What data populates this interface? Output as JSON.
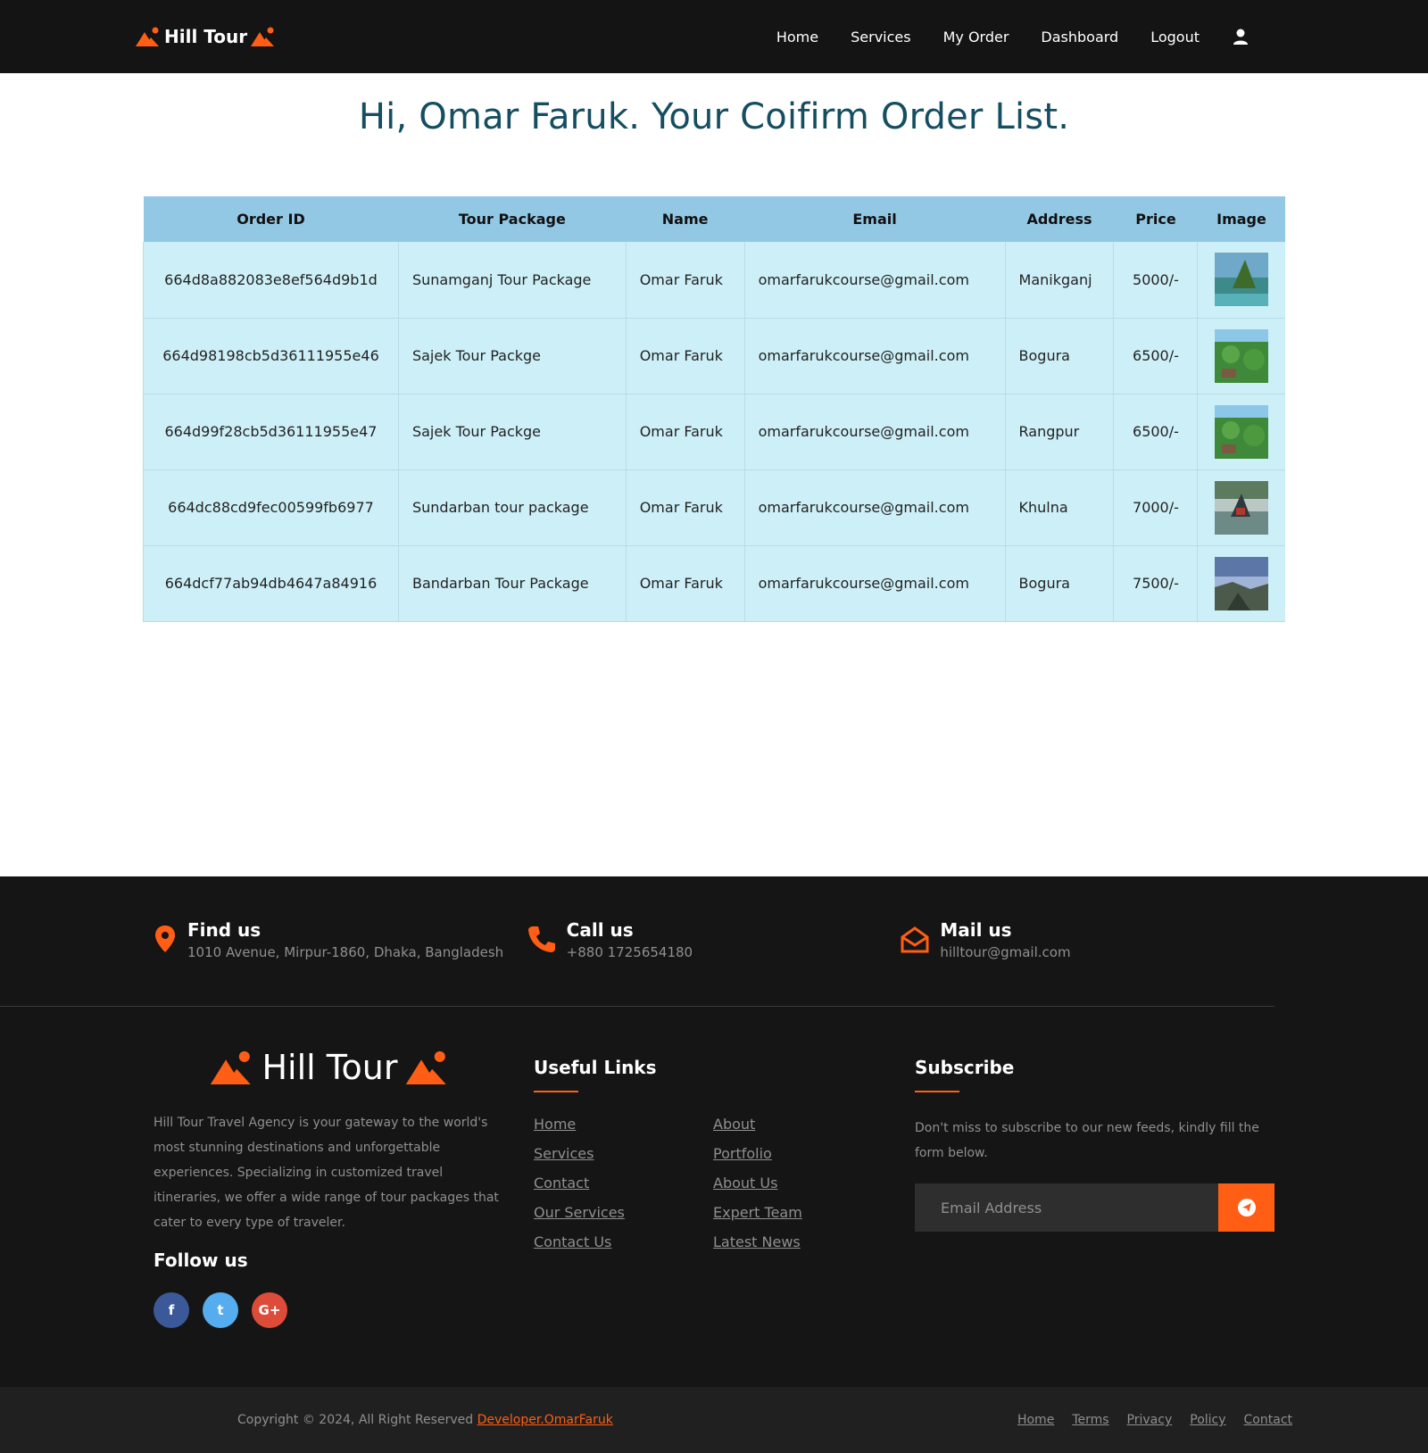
{
  "brand": {
    "name": "Hill Tour"
  },
  "nav": {
    "items": [
      "Home",
      "Services",
      "My Order",
      "Dashboard",
      "Logout"
    ],
    "user_icon": "user-icon"
  },
  "page": {
    "title": "Hi, Omar Faruk. Your Coifirm Order List."
  },
  "orders": {
    "headers": [
      "Order ID",
      "Tour Package",
      "Name",
      "Email",
      "Address",
      "Price",
      "Image"
    ],
    "rows": [
      {
        "id": "664d8a882083e8ef564d9b1d",
        "package": "Sunamganj Tour Package",
        "name": "Omar Faruk",
        "email": "omarfarukcourse@gmail.com",
        "address": "Manikganj",
        "price": "5000/-"
      },
      {
        "id": "664d98198cb5d36111955e46",
        "package": "Sajek Tour Packge",
        "name": "Omar Faruk",
        "email": "omarfarukcourse@gmail.com",
        "address": "Bogura",
        "price": "6500/-"
      },
      {
        "id": "664d99f28cb5d36111955e47",
        "package": "Sajek Tour Packge",
        "name": "Omar Faruk",
        "email": "omarfarukcourse@gmail.com",
        "address": "Rangpur",
        "price": "6500/-"
      },
      {
        "id": "664dc88cd9fec00599fb6977",
        "package": "Sundarban tour package",
        "name": "Omar Faruk",
        "email": "omarfarukcourse@gmail.com",
        "address": "Khulna",
        "price": "7000/-"
      },
      {
        "id": "664dcf77ab94db4647a84916",
        "package": "Bandarban Tour Package",
        "name": "Omar Faruk",
        "email": "omarfarukcourse@gmail.com",
        "address": "Bogura",
        "price": "7500/-"
      }
    ]
  },
  "footer": {
    "contacts": [
      {
        "title": "Find us",
        "text": "1010 Avenue, Mirpur-1860, Dhaka, Bangladesh",
        "icon": "map-pin-icon"
      },
      {
        "title": "Call us",
        "text": "+880 1725654180",
        "icon": "phone-icon"
      },
      {
        "title": "Mail us",
        "text": "hilltour@gmail.com",
        "icon": "envelope-open-icon"
      }
    ],
    "logo_text": "Hill Tour",
    "about": "Hill Tour Travel Agency is your gateway to the world's most stunning destinations and unforgettable experiences. Specializing in customized travel itineraries, we offer a wide range of tour packages that cater to every type of traveler.",
    "follow_title": "Follow us",
    "social": [
      {
        "name": "facebook",
        "glyph": "f"
      },
      {
        "name": "twitter",
        "glyph": "t"
      },
      {
        "name": "google-plus",
        "glyph": "G+"
      }
    ],
    "useful_links_title": "Useful Links",
    "useful_links": [
      "Home",
      "About",
      "Services",
      "Portfolio",
      "Contact",
      "About Us",
      "Our Services",
      "Expert Team",
      "Contact Us",
      "Latest News"
    ],
    "subscribe_title": "Subscribe",
    "subscribe_text": "Don't miss to subscribe to our new feeds, kindly fill the form below.",
    "subscribe_placeholder": "Email Address"
  },
  "copyright": {
    "text": "Copyright © 2024, All Right Reserved ",
    "link": "Developer.OmarFaruk",
    "links": [
      "Home",
      "Terms",
      "Privacy",
      "Policy",
      "Contact"
    ]
  },
  "colors": {
    "accent": "#ff5e14",
    "dark": "#151515",
    "title": "#154e60",
    "table_header": "#93c8e5",
    "table_row": "#cdf0f8"
  }
}
